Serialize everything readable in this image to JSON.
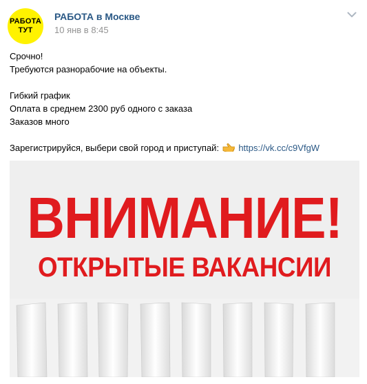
{
  "post": {
    "author": "РАБОТА в Москве",
    "date": "10 янв в 8:45",
    "avatar": {
      "line1": "РАБОТА",
      "line2": "ТУТ",
      "background": "#fff200"
    },
    "menu_icon": "chevron-down-icon",
    "text": {
      "line1": "Срочно!",
      "line2": "Требуются разнорабочие на объекты.",
      "line3": "Гибкий график",
      "line4": "Оплата в среднем 2300 руб одного с заказа",
      "line5": "Заказов много",
      "line6": "Зарегистрируйся, выбери свой город и приступай:",
      "emoji_icon": "pointing-hand-icon",
      "link": "https://vk.cc/c9VfgW"
    },
    "image": {
      "title": "ВНИМАНИЕ!",
      "subtitle": "ОТКРЫТЫЕ ВАКАНСИИ",
      "text_color": "#e01b1e"
    }
  },
  "colors": {
    "link": "#2a5885",
    "date": "#939393"
  }
}
